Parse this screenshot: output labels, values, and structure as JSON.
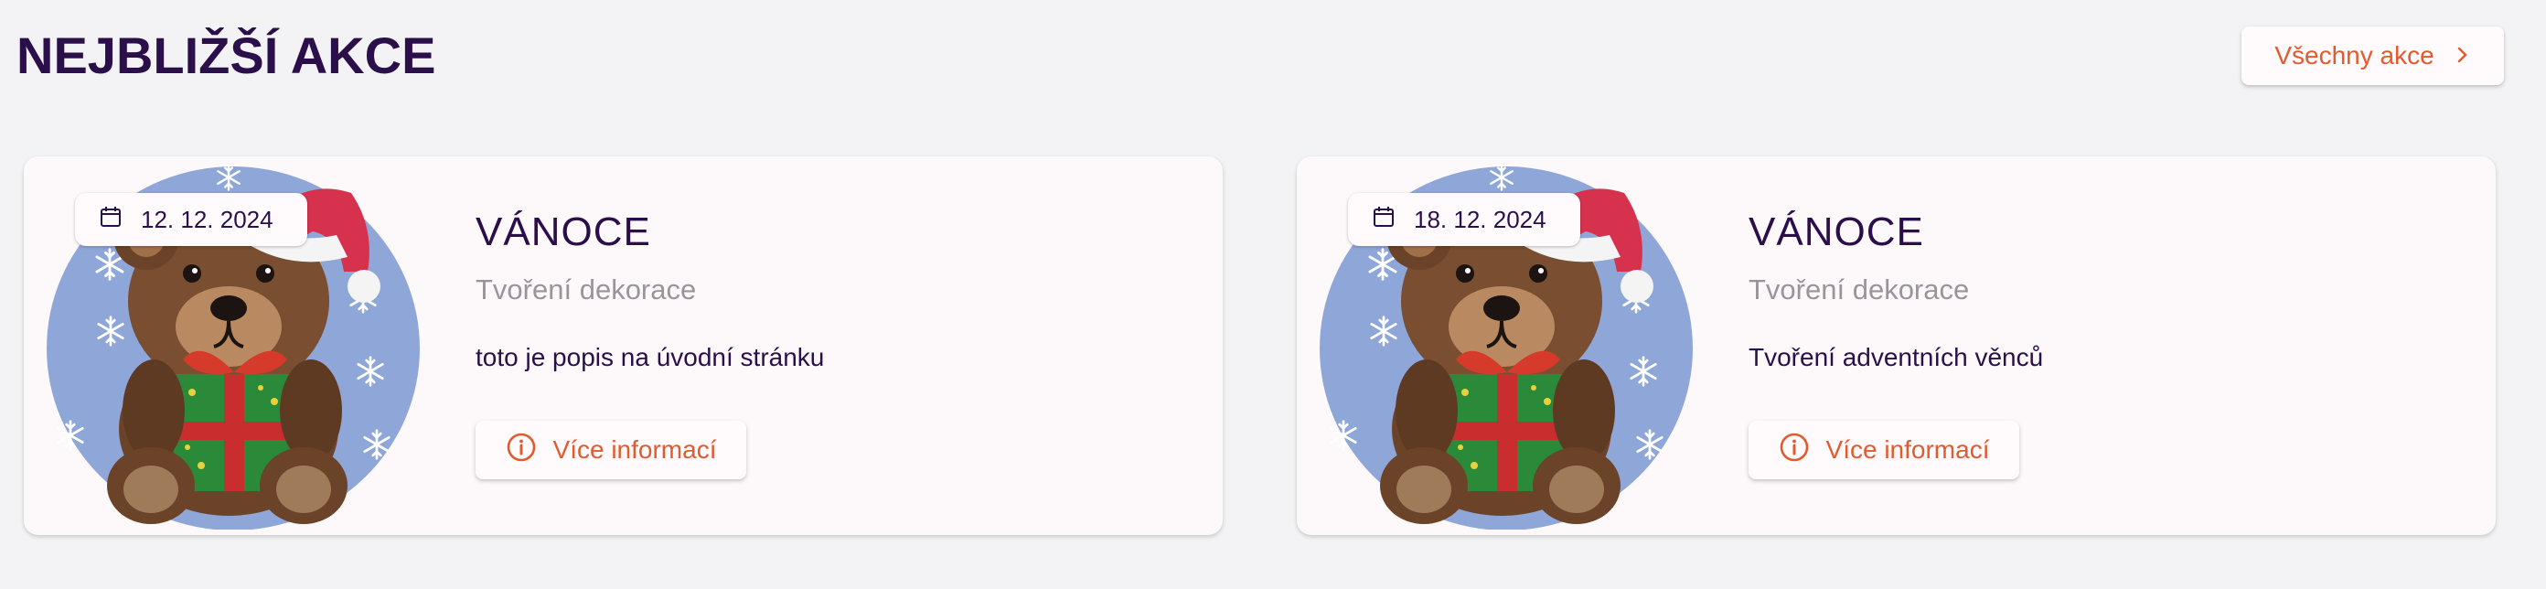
{
  "section": {
    "title": "NEJBLIŽŠÍ AKCE",
    "all_events_label": "Všechny akce"
  },
  "colors": {
    "accent": "#e35a2e",
    "text": "#2b0f4a",
    "muted": "#9a949d",
    "background": "#f3f3f5",
    "card": "#fdf8fa"
  },
  "icons": {
    "all_events": "chevron-right-icon",
    "date": "calendar-icon",
    "more": "info-circle-icon"
  },
  "events": [
    {
      "date": "12. 12. 2024",
      "title": "VÁNOCE",
      "subtitle": "Tvoření dekorace",
      "description": "toto je popis na úvodní stránku",
      "button_label": "Více informací",
      "image_subject": "teddy bear with Santa hat holding gift"
    },
    {
      "date": "18. 12. 2024",
      "title": "VÁNOCE",
      "subtitle": "Tvoření dekorace",
      "description": "Tvoření adventních věnců",
      "button_label": "Více informací",
      "image_subject": "teddy bear with Santa hat holding gift"
    }
  ]
}
